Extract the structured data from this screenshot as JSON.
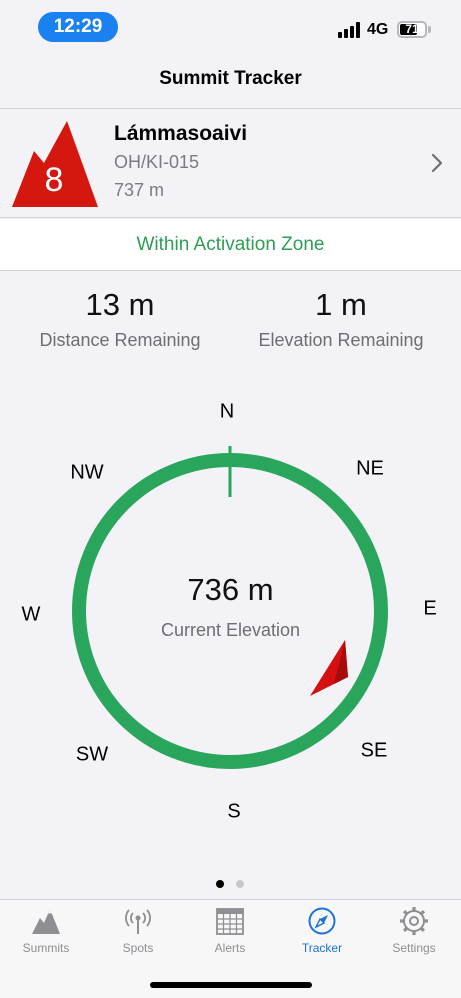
{
  "status_bar": {
    "time": "12:29",
    "network": "4G",
    "battery": "71",
    "battery_level": 0.71
  },
  "nav": {
    "title": "Summit Tracker"
  },
  "summit": {
    "badge_number": "8",
    "name": "Lámmasoaivi",
    "reference": "OH/KI-015",
    "altitude": "737 m",
    "badge_color": "#d4180f"
  },
  "activation": {
    "text": "Within Activation Zone",
    "color": "#2e9e55"
  },
  "stats": {
    "distance": {
      "value": "13 m",
      "label": "Distance Remaining"
    },
    "elevation": {
      "value": "1 m",
      "label": "Elevation Remaining"
    }
  },
  "compass": {
    "directions": {
      "n": "N",
      "ne": "NE",
      "e": "E",
      "se": "SE",
      "s": "S",
      "sw": "SW",
      "w": "W",
      "nw": "NW"
    },
    "ring_color": "#2aa65c",
    "pointer_color": "#d41010",
    "current_elevation": "736 m",
    "current_elevation_label": "Current Elevation"
  },
  "pager": {
    "pages": 2,
    "active_page": 1
  },
  "tabs": [
    {
      "label": "Summits",
      "icon": "mountain-icon",
      "active": false
    },
    {
      "label": "Spots",
      "icon": "antenna-icon",
      "active": false
    },
    {
      "label": "Alerts",
      "icon": "calendar-icon",
      "active": false
    },
    {
      "label": "Tracker",
      "icon": "compass-icon",
      "active": true
    },
    {
      "label": "Settings",
      "icon": "gear-icon",
      "active": false
    }
  ]
}
